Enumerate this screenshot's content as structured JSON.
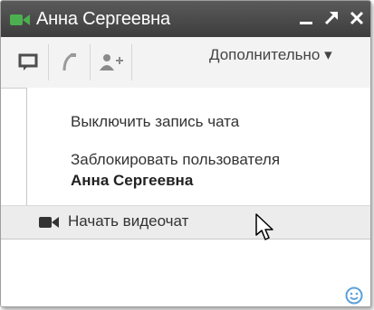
{
  "window": {
    "title": "Анна Сергеевна",
    "icons": {
      "video": "video-camera-icon",
      "minimize": "minimize-icon",
      "popout": "popout-arrow-icon",
      "close": "close-icon"
    }
  },
  "toolbar": {
    "buttons": [
      "chat-bubble-icon",
      "phone-icon",
      "add-person-icon"
    ],
    "more_label": "Дополнительно ▾"
  },
  "menu": {
    "items": [
      {
        "label": "Выключить запись чата"
      },
      {
        "label": "Заблокировать пользователя",
        "sublabel": "Анна Сергеевна"
      },
      {
        "label": "Начать видеочат",
        "icon": "video-camera-icon"
      }
    ]
  },
  "composer": {
    "value": "",
    "icon": "smiley-icon"
  },
  "colors": {
    "titlebar": "#474747",
    "video_icon": "#4caf50",
    "toolbar": "#f3f3f3",
    "hover_row": "#ececec",
    "smiley": "#5aa0d8"
  }
}
